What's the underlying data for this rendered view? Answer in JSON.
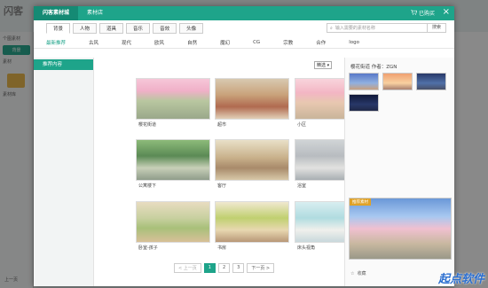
{
  "background": {
    "logo": "闪客",
    "left_items": [
      "个图素材",
      "背景",
      "素材",
      "素材库"
    ],
    "left_bottom": "上一页"
  },
  "modal": {
    "tabs": [
      "闪客素材城",
      "素材店"
    ],
    "cart_label": "已购买",
    "categories": [
      "背景",
      "人物",
      "道具",
      "音乐",
      "音效",
      "头像"
    ],
    "search_placeholder": "输入需要的素材名称",
    "search_button": "搜索",
    "subcategories": [
      "最新推荐",
      "古风",
      "现代",
      "欧风",
      "自然",
      "魔幻",
      "CG",
      "宗教",
      "合作",
      "logo"
    ],
    "sidebar_item": "推荐内容",
    "sort_label": "精选",
    "cards": [
      {
        "caption": "樱花街道"
      },
      {
        "caption": "超市"
      },
      {
        "caption": "小区"
      },
      {
        "caption": "公寓楼下"
      },
      {
        "caption": "客厅"
      },
      {
        "caption": "浴室"
      },
      {
        "caption": "卧室-孩子"
      },
      {
        "caption": "书房"
      },
      {
        "caption": "床头视角"
      }
    ],
    "pager": {
      "prev": "< 上一页",
      "pages": [
        "1",
        "2",
        "3"
      ],
      "next": "下一页 >"
    },
    "detail": {
      "title": "樱花街道   作者：ZGN",
      "ribbon": "推荐素材",
      "fav": "收藏"
    }
  },
  "watermark": "起点软件"
}
